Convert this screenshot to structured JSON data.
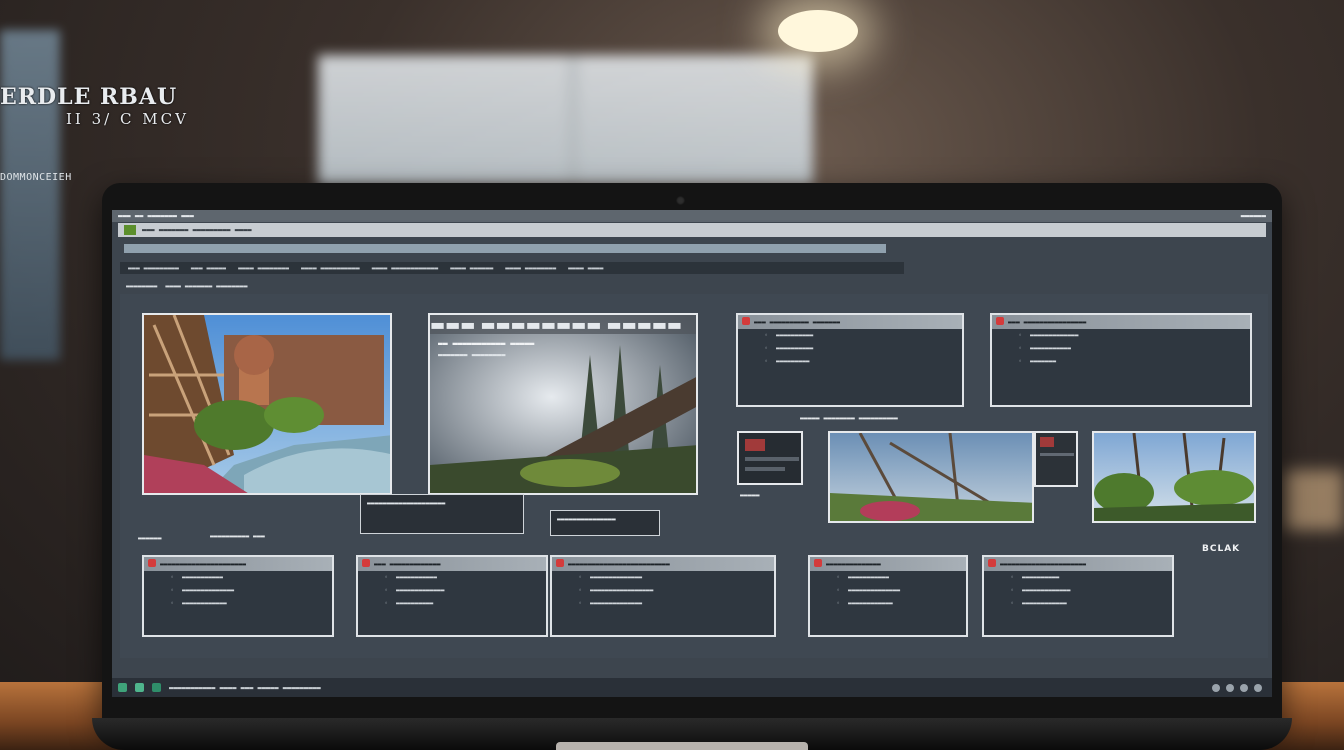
{
  "wall": {
    "title_line1": "ERDLE RBAU",
    "title_line2": "II 3/ C MCV",
    "caption": "DOMMONCEIEH"
  },
  "titlebar": {
    "left_text": "▬▬▬ ▬▬ ▬▬▬▬▬▬▬ ▬▬▬",
    "right_text": "▬▬▬▬▬▬"
  },
  "addressbar": {
    "text": "▬▬▬ ▬▬▬▬▬▬▬ ▬▬▬▬▬▬▬▬▬ ▬▬▬▬"
  },
  "searchbar": {
    "placeholder": ""
  },
  "menubar": {
    "items": [
      "▬▬▬ ▬▬▬▬▬▬▬▬▬",
      "▬▬▬ ▬▬▬▬▬",
      "▬▬▬▬ ▬▬▬▬▬▬▬▬",
      "▬▬▬▬ ▬▬▬▬▬▬▬▬▬▬",
      "▬▬▬▬ ▬▬▬▬▬▬▬▬▬▬▬▬",
      "▬▬▬▬ ▬▬▬▬▬▬",
      "▬▬▬▬ ▬▬▬▬▬▬▬▬",
      "▬▬▬▬ ▬▬▬▬"
    ]
  },
  "breadcrumb": [
    "▬▬▬▬▬▬▬▬",
    "▬▬▬▬ ▬▬▬▬▬▬▬ ▬▬▬▬▬▬▬▬"
  ],
  "cards": {
    "tile2_header": "▬▬▬ ▬▬▬▬▬▬▬▬ ▬▬▬▬▬",
    "tile2_overlay_line1": "▬▬ ▬▬▬▬▬▬▬▬▬▬▬ ▬▬▬▬▬",
    "tile2_overlay_line2": "▬▬▬▬▬▬▬ ▬▬▬▬▬▬▬▬",
    "tile3": {
      "header": "▬▬▬ ▬▬▬▬▬▬▬▬▬▬ ▬▬▬▬▬▬▬",
      "rows": [
        "▬▬▬▬▬▬▬▬▬▬",
        "▬▬▬▬▬▬▬▬▬▬",
        "▬▬▬▬▬▬▬▬▬"
      ]
    },
    "tile4": {
      "header": "▬▬▬ ▬▬▬▬▬▬▬▬▬▬▬▬▬▬▬▬",
      "rows": [
        "▬▬▬▬▬▬▬▬▬▬▬▬▬",
        "▬▬▬▬▬▬▬▬▬▬▬",
        "▬▬▬▬▬▬▬"
      ]
    },
    "tile3_caption": "▬▬▬▬▬ ▬▬▬▬▬▬▬▬ ▬▬▬▬▬▬▬▬▬▬",
    "small_thumb_caption": "▬▬▬▬▬",
    "bottom": [
      {
        "header": "▬▬▬▬▬▬▬▬▬▬▬▬▬▬▬▬▬▬▬▬▬▬",
        "rows": [
          "▬▬▬▬▬▬▬▬▬▬▬",
          "▬▬▬▬▬▬▬▬▬▬▬▬▬▬",
          "▬▬▬▬▬▬▬▬▬▬▬▬"
        ]
      },
      {
        "header": "▬▬▬ ▬▬▬▬▬▬▬▬▬▬▬▬▬",
        "rows": [
          "▬▬▬▬▬▬▬▬▬▬▬",
          "▬▬▬▬▬▬▬▬▬▬▬▬▬",
          "▬▬▬▬▬▬▬▬▬▬"
        ]
      },
      {
        "header": "▬▬▬▬▬▬▬▬▬▬▬▬▬▬▬▬▬▬▬▬▬▬▬▬▬▬",
        "rows": [
          "▬▬▬▬▬▬▬▬▬▬▬▬▬▬",
          "▬▬▬▬▬▬▬▬▬▬▬▬▬▬▬▬▬",
          "▬▬▬▬▬▬▬▬▬▬▬▬▬▬"
        ]
      },
      {
        "header": "▬▬▬▬▬▬▬▬▬▬▬▬▬▬",
        "rows": [
          "▬▬▬▬▬▬▬▬▬▬▬",
          "▬▬▬▬▬▬▬▬▬▬▬▬▬▬",
          "▬▬▬▬▬▬▬▬▬▬▬▬"
        ]
      },
      {
        "header": "▬▬▬▬▬▬▬▬▬▬▬▬▬▬▬▬▬▬▬▬▬▬",
        "rows": [
          "▬▬▬▬▬▬▬▬▬▬",
          "▬▬▬▬▬▬▬▬▬▬▬▬▬",
          "▬▬▬▬▬▬▬▬▬▬▬▬"
        ]
      }
    ],
    "bottom_left_caption": "▬▬▬▬▬▬",
    "bottom_left_caption2": "▬▬▬▬▬▬▬▬▬▬ ▬▬▬",
    "mid_caption_box1": "▬▬▬▬▬▬▬▬▬▬▬▬▬▬▬▬▬▬▬▬",
    "mid_caption_box2": "▬▬▬▬▬▬▬▬▬▬▬▬▬▬▬",
    "side_label": "BCLAK"
  },
  "taskbar": {
    "text": "▬▬▬▬▬▬▬▬▬▬▬ ▬▬▬▬ ▬▬▬ ▬▬▬▬▬ ▬▬▬▬▬▬▬▬▬"
  },
  "colors": {
    "accent_red": "#d43b3b",
    "green": "#5c8f2c",
    "screen_bg": "#3d454e"
  }
}
